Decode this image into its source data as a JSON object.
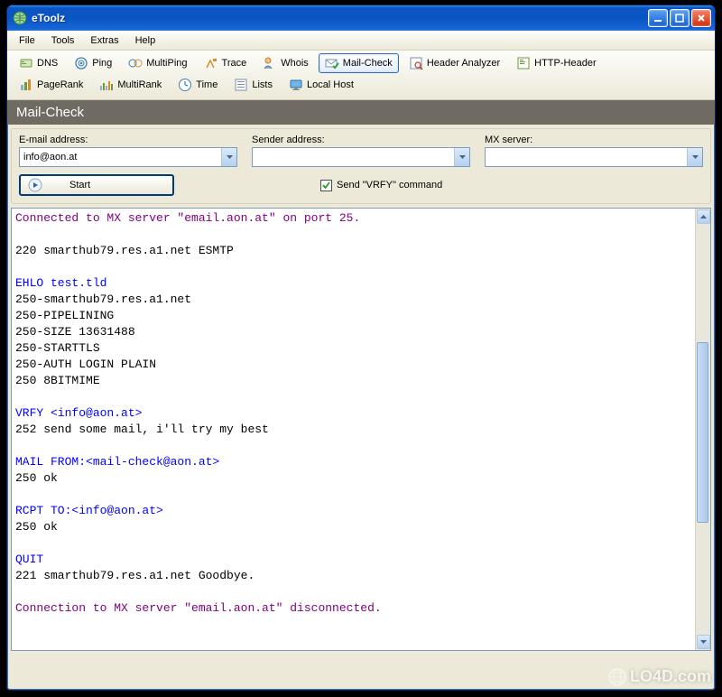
{
  "window": {
    "title": "eToolz"
  },
  "menu": {
    "items": [
      "File",
      "Tools",
      "Extras",
      "Help"
    ]
  },
  "toolbar": {
    "row1": [
      {
        "label": "DNS",
        "icon": "dns-icon"
      },
      {
        "label": "Ping",
        "icon": "ping-icon"
      },
      {
        "label": "MultiPing",
        "icon": "multiping-icon"
      },
      {
        "label": "Trace",
        "icon": "trace-icon"
      },
      {
        "label": "Whois",
        "icon": "whois-icon"
      },
      {
        "label": "Mail-Check",
        "icon": "mailcheck-icon",
        "active": true
      },
      {
        "label": "Header Analyzer",
        "icon": "headeranalyzer-icon"
      },
      {
        "label": "HTTP-Header",
        "icon": "httpheader-icon"
      }
    ],
    "row2": [
      {
        "label": "PageRank",
        "icon": "pagerank-icon"
      },
      {
        "label": "MultiRank",
        "icon": "multirank-icon"
      },
      {
        "label": "Time",
        "icon": "time-icon"
      },
      {
        "label": "Lists",
        "icon": "lists-icon"
      },
      {
        "label": "Local Host",
        "icon": "localhost-icon"
      }
    ]
  },
  "section": {
    "title": "Mail-Check"
  },
  "form": {
    "email_label": "E-mail address:",
    "email_value": "info@aon.at",
    "sender_label": "Sender address:",
    "sender_value": "",
    "mx_label": "MX server:",
    "mx_value": "",
    "start_label": "Start",
    "vrfy_checked": true,
    "vrfy_label": "Send \"VRFY\" command"
  },
  "output": {
    "lines": [
      {
        "text": "Connected to MX server \"email.aon.at\" on port 25.",
        "c": "purple"
      },
      {
        "text": "",
        "c": ""
      },
      {
        "text": "220 smarthub79.res.a1.net ESMTP",
        "c": ""
      },
      {
        "text": "",
        "c": ""
      },
      {
        "text": "EHLO test.tld",
        "c": "blue"
      },
      {
        "text": "250-smarthub79.res.a1.net",
        "c": ""
      },
      {
        "text": "250-PIPELINING",
        "c": ""
      },
      {
        "text": "250-SIZE 13631488",
        "c": ""
      },
      {
        "text": "250-STARTTLS",
        "c": ""
      },
      {
        "text": "250-AUTH LOGIN PLAIN",
        "c": ""
      },
      {
        "text": "250 8BITMIME",
        "c": ""
      },
      {
        "text": "",
        "c": ""
      },
      {
        "text": "VRFY <info@aon.at>",
        "c": "blue"
      },
      {
        "text": "252 send some mail, i'll try my best",
        "c": ""
      },
      {
        "text": "",
        "c": ""
      },
      {
        "text": "MAIL FROM:<mail-check@aon.at>",
        "c": "blue"
      },
      {
        "text": "250 ok",
        "c": ""
      },
      {
        "text": "",
        "c": ""
      },
      {
        "text": "RCPT TO:<info@aon.at>",
        "c": "blue"
      },
      {
        "text": "250 ok",
        "c": ""
      },
      {
        "text": "",
        "c": ""
      },
      {
        "text": "QUIT",
        "c": "blue"
      },
      {
        "text": "221 smarthub79.res.a1.net Goodbye.",
        "c": ""
      },
      {
        "text": "",
        "c": ""
      },
      {
        "text": "Connection to MX server \"email.aon.at\" disconnected.",
        "c": "purple"
      }
    ]
  },
  "watermark": "LO4D.com"
}
